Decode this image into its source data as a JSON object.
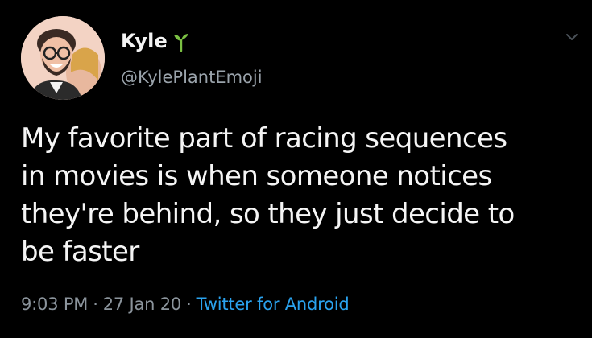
{
  "user": {
    "display_name": "Kyle",
    "handle": "@KylePlantEmoji",
    "name_emoji": "sprout-icon"
  },
  "tweet": {
    "lines": [
      "My favorite part of racing sequences",
      "in movies is when someone notices",
      "they're behind, so they just decide to",
      "be faster"
    ]
  },
  "meta": {
    "time": "9:03 PM",
    "separator": "·",
    "date": "27 Jan 20",
    "source": "Twitter for Android"
  },
  "colors": {
    "background": "#000000",
    "text": "#f5f5f5",
    "secondary": "#8b949c",
    "link": "#2aa3ef",
    "sprout": "#7bc043"
  }
}
